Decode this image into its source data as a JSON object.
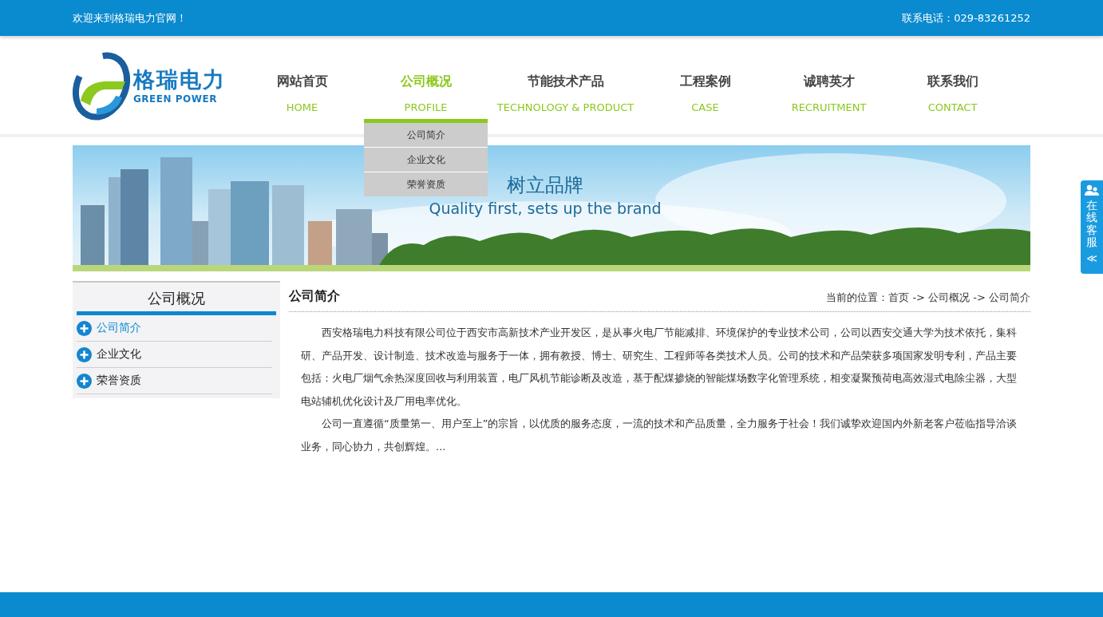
{
  "top_bar": {
    "welcome": "欢迎来到格瑞电力官网！",
    "phone": "联系电话：029-83261252"
  },
  "logo": {
    "name": "格瑞电力",
    "tagline": "GREEN POWER"
  },
  "nav": [
    {
      "label": "网站首页",
      "sub": "HOME",
      "selected": false
    },
    {
      "label": "公司概况",
      "sub": "PROFILE",
      "selected": true,
      "dropdown": [
        "公司简介",
        "企业文化",
        "荣誉资质"
      ]
    },
    {
      "label": "节能技术产品",
      "sub": "TECHNOLOGY & PRODUCT",
      "selected": false
    },
    {
      "label": "工程案例",
      "sub": "CASE",
      "selected": false
    },
    {
      "label": "诚聘英才",
      "sub": "RECRUITMENT",
      "selected": false
    },
    {
      "label": "联系我们",
      "sub": "CONTACT",
      "selected": false
    }
  ],
  "banner": {
    "title": "树立品牌",
    "subtitle": "Quality first, sets up the brand"
  },
  "sidebar": {
    "title": "公司概况",
    "items": [
      {
        "label": "公司简介",
        "selected": true
      },
      {
        "label": "企业文化",
        "selected": false
      },
      {
        "label": "荣誉资质",
        "selected": false
      }
    ]
  },
  "content": {
    "title": "公司简介",
    "breadcrumb": "当前的位置：首页 -> 公司概况 -> 公司简介",
    "paragraphs": [
      "西安格瑞电力科技有限公司位于西安市高新技术产业开发区，是从事火电厂节能减排、环境保护的专业技术公司，公司以西安交通大学为技术依托，集科研、产品开发、设计制造、技术改造与服务于一体，拥有教授、博士、研究生、工程师等各类技术人员。公司的技术和产品荣获多项国家发明专利，产品主要包括：火电厂烟气余热深度回收与利用装置，电厂风机节能诊断及改造，基于配煤掺烧的智能煤场数字化管理系统，相变凝聚预荷电高效湿式电除尘器，大型电站辅机优化设计及厂用电率优化。",
      "公司一直遵循“质量第一、用户至上”的宗旨，以优质的服务态度，一流的技术和产品质量，全力服务于社会！我们诚挚欢迎国内外新老客户莅临指导洽谈业务，同心协力，共创辉煌。..."
    ]
  },
  "service_tab": {
    "label": "在线客服",
    "arrow": "≪"
  }
}
